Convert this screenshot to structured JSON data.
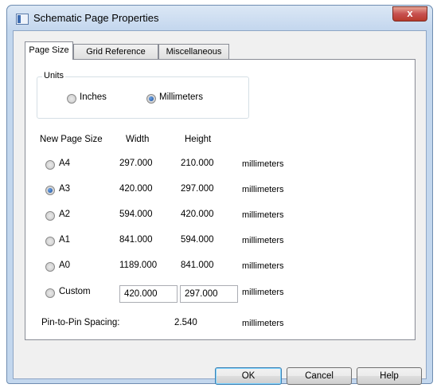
{
  "window": {
    "title": "Schematic Page Properties",
    "close_label": "x"
  },
  "tabs": [
    "Page Size",
    "Grid Reference",
    "Miscellaneous"
  ],
  "units": {
    "group_label": "Units",
    "inches": "Inches",
    "millimeters": "Millimeters",
    "selected": "Millimeters"
  },
  "headers": {
    "new_page_size": "New Page Size",
    "width": "Width",
    "height": "Height"
  },
  "sizes": [
    {
      "label": "A4",
      "width": "297.000",
      "height": "210.000",
      "unit": "millimeters",
      "checked": false
    },
    {
      "label": "A3",
      "width": "420.000",
      "height": "297.000",
      "unit": "millimeters",
      "checked": true
    },
    {
      "label": "A2",
      "width": "594.000",
      "height": "420.000",
      "unit": "millimeters",
      "checked": false
    },
    {
      "label": "A1",
      "width": "841.000",
      "height": "594.000",
      "unit": "millimeters",
      "checked": false
    },
    {
      "label": "A0",
      "width": "1189.000",
      "height": "841.000",
      "unit": "millimeters",
      "checked": false
    }
  ],
  "custom": {
    "label": "Custom",
    "width": "420.000",
    "height": "297.000",
    "unit": "millimeters"
  },
  "pin_spacing": {
    "label": "Pin-to-Pin Spacing:",
    "value": "2.540",
    "unit": "millimeters"
  },
  "buttons": {
    "ok": "OK",
    "cancel": "Cancel",
    "help": "Help"
  }
}
